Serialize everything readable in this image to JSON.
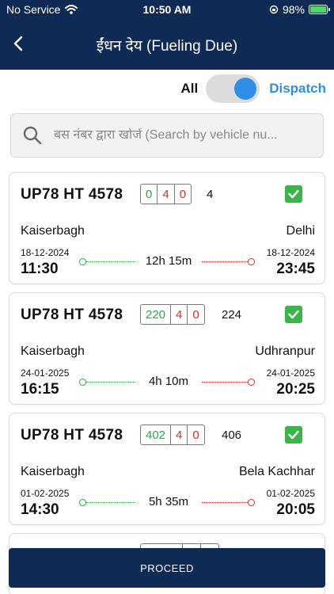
{
  "status_bar": {
    "carrier": "No Service",
    "time": "10:50 AM",
    "battery": "98%",
    "battery_level": 0.98
  },
  "header": {
    "title": "ईंधन देय (Fueling Due)"
  },
  "filter_toggle": {
    "left_label": "All",
    "right_label": "Dispatch",
    "active": "Dispatch"
  },
  "search": {
    "placeholder": "बस नंबर द्वारा खोजें (Search by vehicle nu..."
  },
  "trips": [
    {
      "vehicle_no": "UP78 HT 4578",
      "count_green": "0",
      "count_mid": "4",
      "count_red": "0",
      "total": "4",
      "checked": true,
      "from": "Kaiserbagh",
      "to": "Delhi",
      "from_date": "18-12-2024",
      "to_date": "18-12-2024",
      "from_time": "11:30",
      "to_time": "23:45",
      "duration": "12h 15m"
    },
    {
      "vehicle_no": "UP78 HT 4578",
      "count_green": "220",
      "count_mid": "4",
      "count_red": "0",
      "total": "224",
      "checked": true,
      "from": "Kaiserbagh",
      "to": "Udhranpur",
      "from_date": "24-01-2025",
      "to_date": "24-01-2025",
      "from_time": "16:15",
      "to_time": "20:25",
      "duration": "4h 10m"
    },
    {
      "vehicle_no": "UP78 HT 4578",
      "count_green": "402",
      "count_mid": "4",
      "count_red": "0",
      "total": "406",
      "checked": true,
      "from": "Kaiserbagh",
      "to": "Bela Kachhar",
      "from_date": "01-02-2025",
      "to_date": "01-02-2025",
      "from_time": "14:30",
      "to_time": "20:05",
      "duration": "5h 35m"
    }
  ],
  "footer": {
    "proceed_label": "PROCEED"
  },
  "colors": {
    "navy": "#0f2a54",
    "accent_blue": "#2f8ee6",
    "check_green": "#3bb54a",
    "green": "#2aa84a",
    "red": "#d32f2f"
  }
}
